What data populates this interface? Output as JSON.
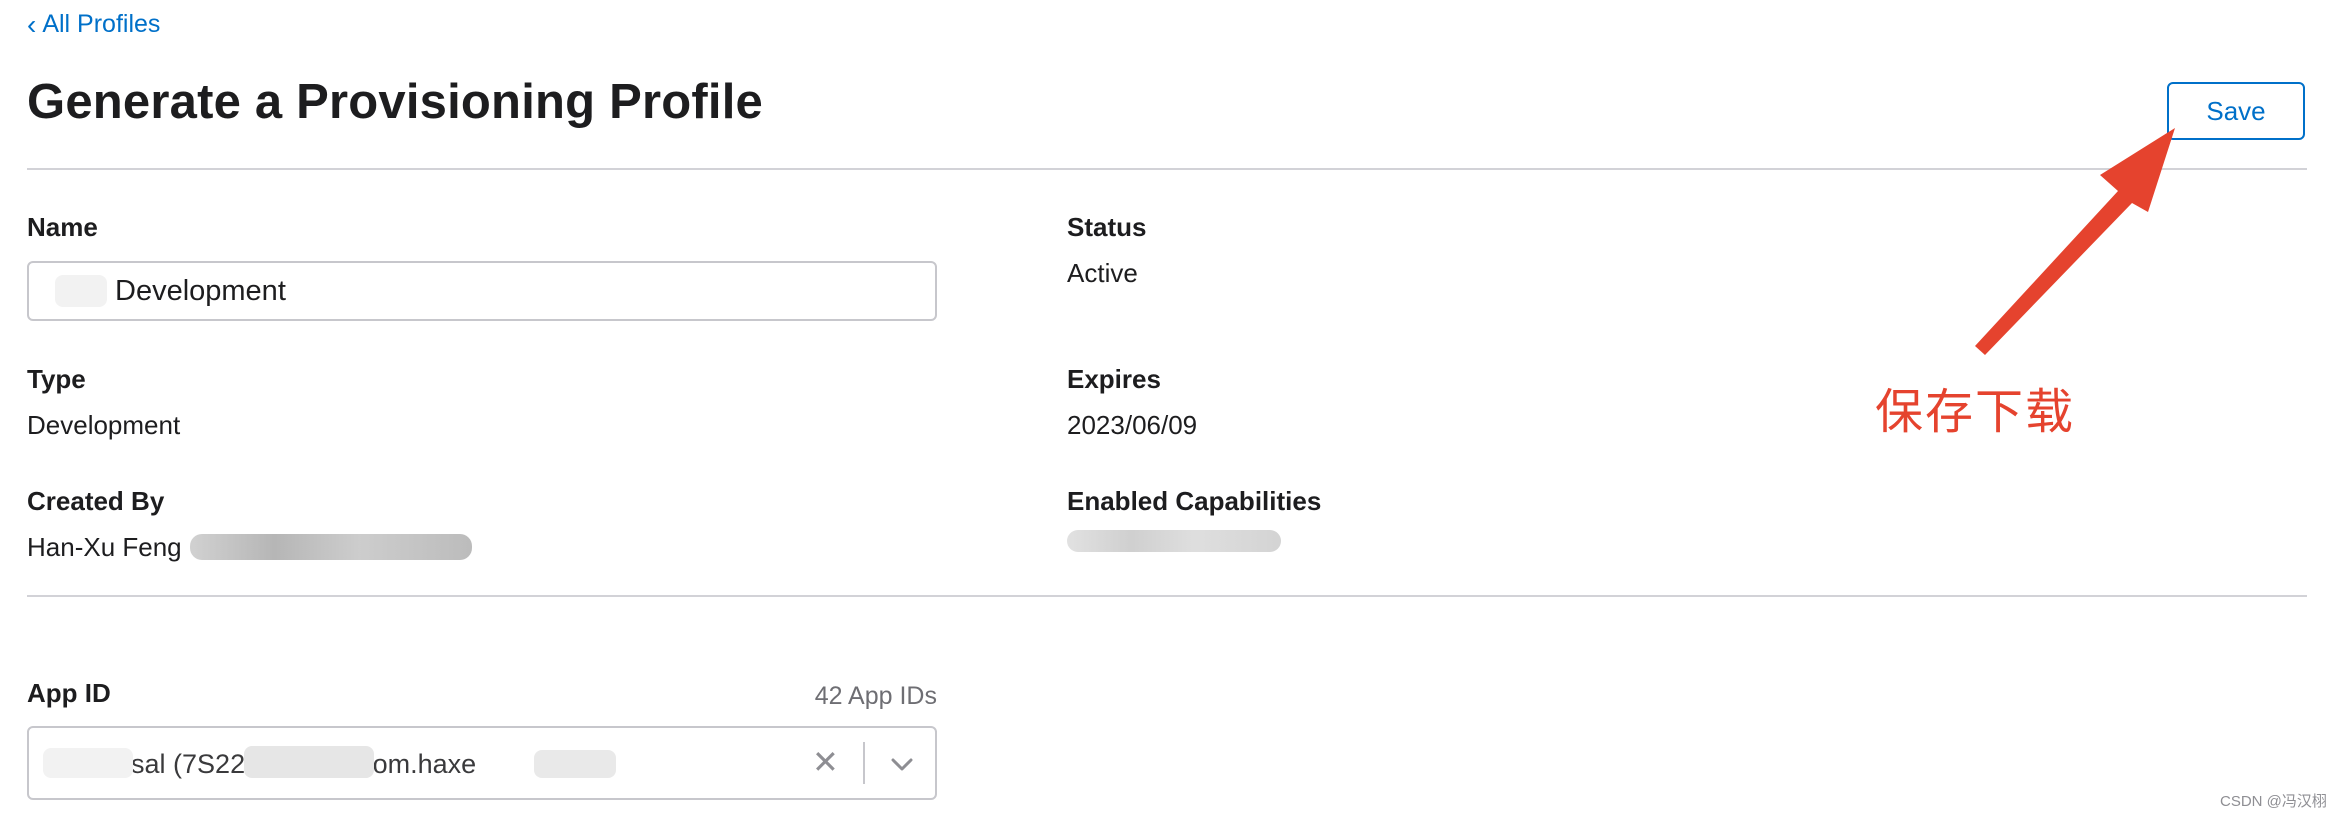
{
  "nav": {
    "back_label": "All Profiles"
  },
  "header": {
    "title": "Generate a Provisioning Profile",
    "save_label": "Save"
  },
  "fields": {
    "name": {
      "label": "Name",
      "value": "Development"
    },
    "status": {
      "label": "Status",
      "value": "Active"
    },
    "type": {
      "label": "Type",
      "value": "Development"
    },
    "expires": {
      "label": "Expires",
      "value": "2023/06/09"
    },
    "created_by": {
      "label": "Created By",
      "value": "Han-Xu Feng"
    },
    "capabilities": {
      "label": "Enabled Capabilities"
    }
  },
  "app_id": {
    "label": "App ID",
    "count": "42 App IDs",
    "selected": "Universal (7S225XXADB.com.haxe"
  },
  "annotation": {
    "text": "保存下载",
    "color": "#e5432e"
  },
  "watermark": "CSDN @冯汉栩",
  "colors": {
    "accent": "#0070c9",
    "annotation": "#e5432e",
    "divider": "#d2d2d7"
  }
}
